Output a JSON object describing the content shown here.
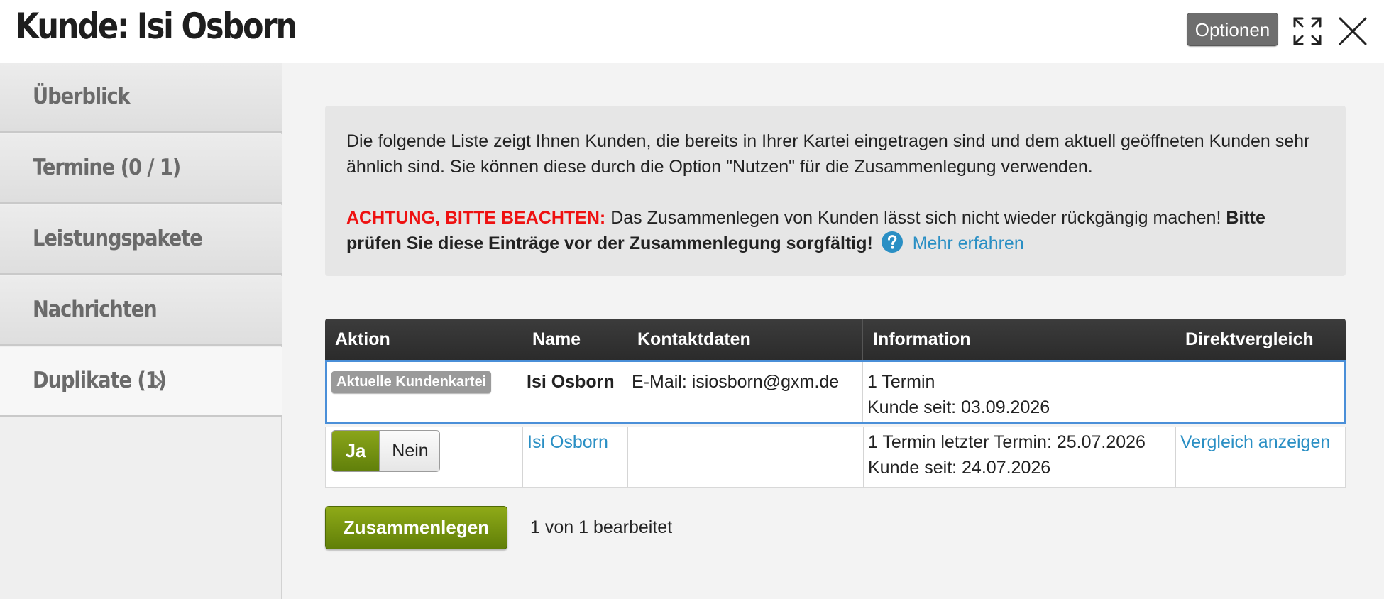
{
  "header": {
    "title": "Kunde: Isi Osborn",
    "options_label": "Optionen",
    "expand_icon": "expand-icon",
    "close_icon": "close-icon"
  },
  "sidebar": {
    "items": [
      {
        "label": "Überblick",
        "active": false
      },
      {
        "label": "Termine (0 / 1)",
        "active": false
      },
      {
        "label": "Leistungspakete",
        "active": false
      },
      {
        "label": "Nachrichten",
        "active": false
      },
      {
        "label": "Duplikate (1)",
        "active": true,
        "icon": "chevron-right-icon"
      }
    ]
  },
  "info": {
    "text": "Die folgende Liste zeigt Ihnen Kunden, die bereits in Ihrer Kartei eingetragen sind und dem aktuell geöffneten Kunden sehr ähnlich sind. Sie können diese durch die Option \"Nutzen\" für die Zusammenlegung verwenden.",
    "warning_label": "ACHTUNG, BITTE BEACHTEN:",
    "warning_text": "Das Zusammenlegen von Kunden lässt sich nicht wieder rückgängig machen!",
    "warning_bold": "Bitte prüfen Sie diese Einträge vor der Zusammenlegung sorgfältig!",
    "help_icon": "question-circle-icon",
    "more_link": "Mehr erfahren"
  },
  "table": {
    "headers": [
      "Aktion",
      "Name",
      "Kontaktdaten",
      "Information",
      "Direktvergleich"
    ],
    "current": {
      "badge": "Aktuelle Kundenkartei",
      "name": "Isi Osborn",
      "contact": "E-Mail: isiosborn@gxm.de",
      "info_line1": "1 Termin",
      "info_line2": "Kunde seit: 03.09.2026",
      "compare": ""
    },
    "duplicate": {
      "yes_label": "Ja",
      "no_label": "Nein",
      "name": "Isi Osborn",
      "contact": "",
      "info_line1": "1 Termin letzter Termin: 25.07.2026",
      "info_line2": "Kunde seit: 24.07.2026",
      "compare": "Vergleich anzeigen"
    }
  },
  "actions": {
    "merge_label": "Zusammenlegen",
    "status": "1 von 1 bearbeitet"
  },
  "colors": {
    "accent_green": "#6f8f10",
    "link_blue": "#2a8fc4",
    "warning_red": "#ee1111",
    "row_highlight": "#4a8fd8"
  }
}
